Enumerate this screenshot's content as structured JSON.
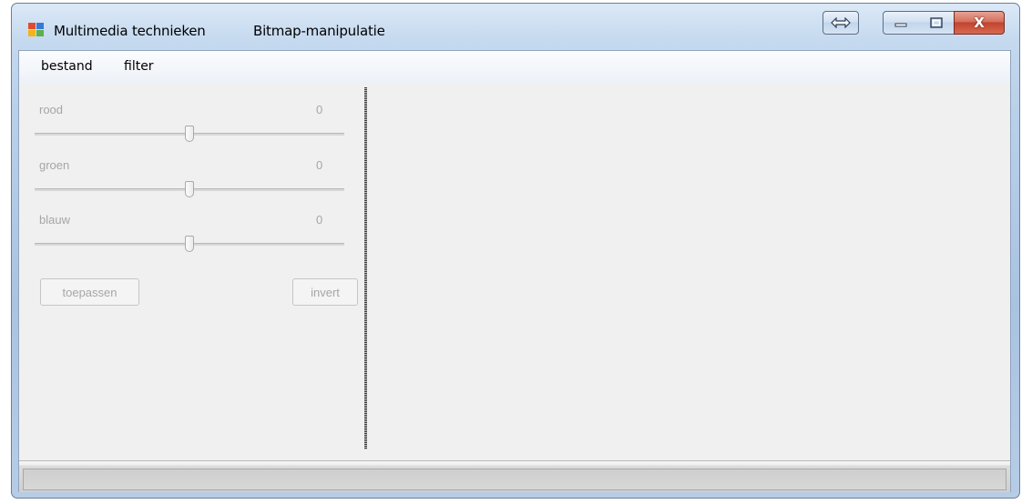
{
  "window": {
    "title_app": "Multimedia technieken",
    "title_doc": "Bitmap-manipulatie",
    "close_glyph": "X"
  },
  "menu": {
    "items": [
      {
        "label": "bestand"
      },
      {
        "label": "filter"
      }
    ]
  },
  "controls": {
    "sliders": [
      {
        "label": "rood",
        "value": "0",
        "level": 0.5
      },
      {
        "label": "groen",
        "value": "0",
        "level": 0.5
      },
      {
        "label": "blauw",
        "value": "0",
        "level": 0.5
      }
    ],
    "apply_button": "toepassen",
    "invert_button": "invert",
    "enabled": false
  },
  "icons": {
    "app": "app-window-icon",
    "swap": "swap-arrows-icon",
    "minimize": "minimize-icon",
    "maximize": "maximize-icon",
    "close": "close-icon"
  },
  "colors": {
    "disabled_text": "#a6a6a6",
    "close_button": "#c24331",
    "client_background": "#f0f0f0"
  }
}
